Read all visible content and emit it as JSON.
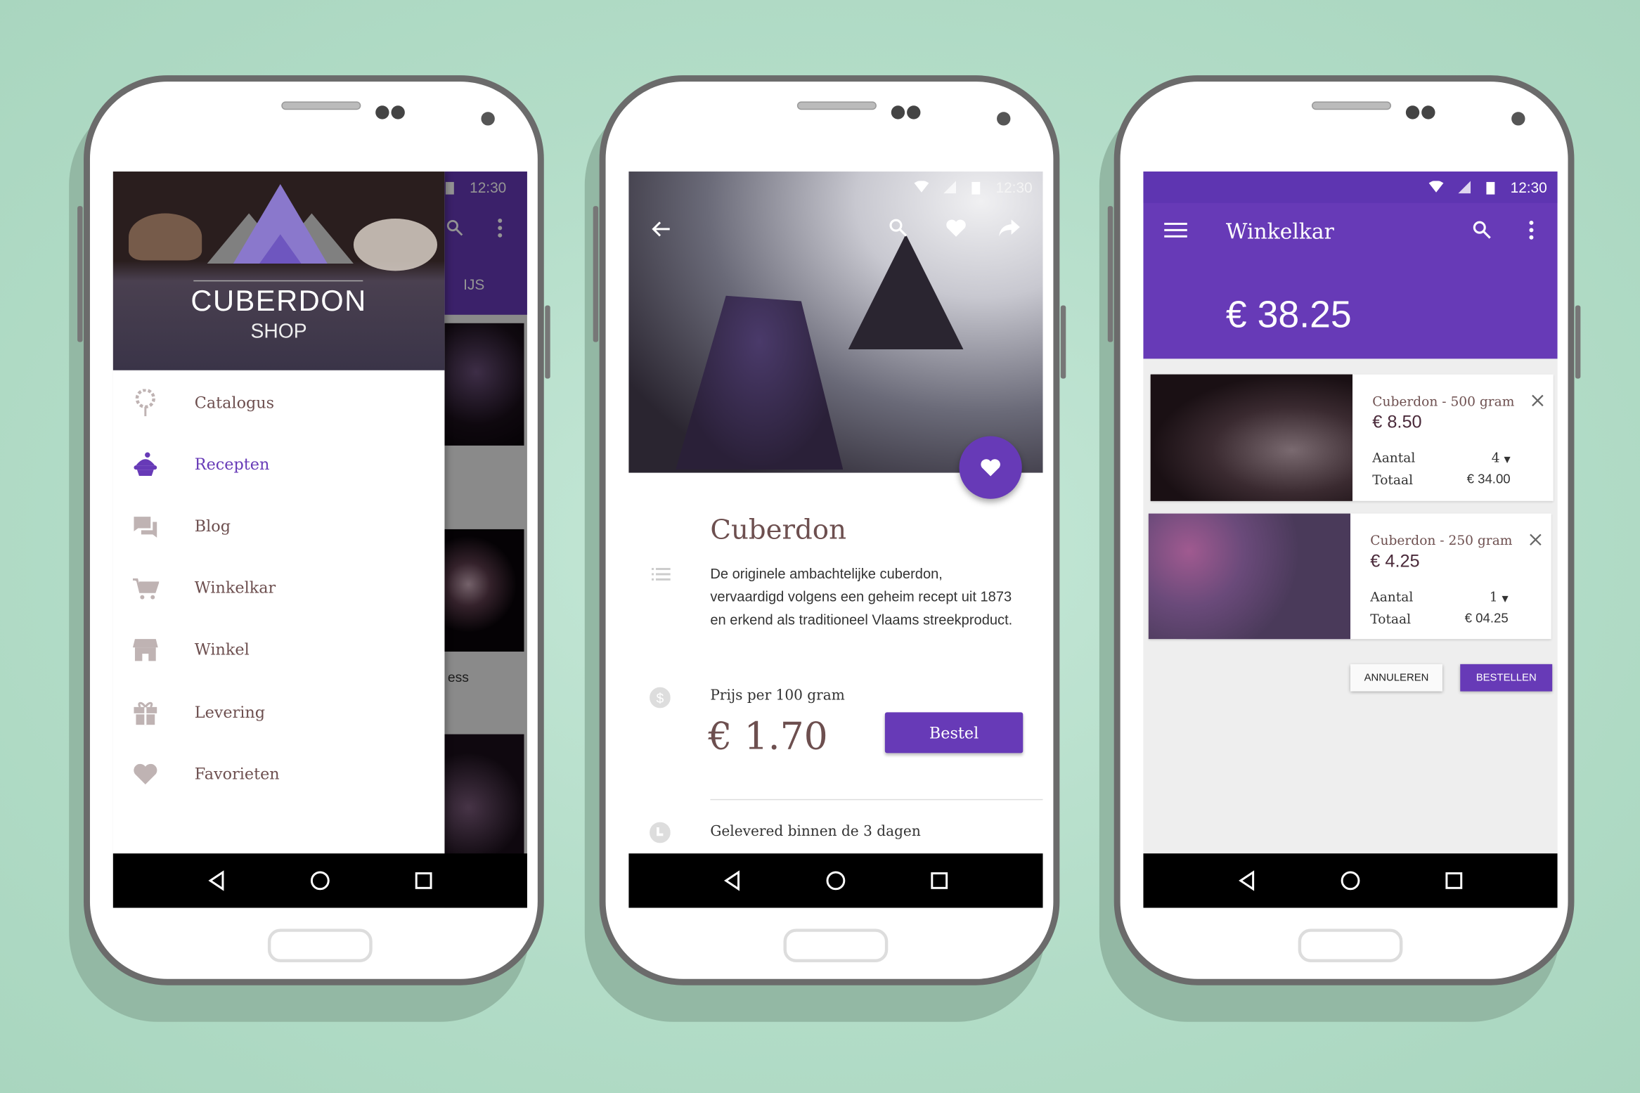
{
  "colors": {
    "accent": "#673ab7",
    "accent_dark": "#5e35b1",
    "text_brown": "#6d4f4f",
    "background": "#b2dcc7"
  },
  "status": {
    "time": "12:30"
  },
  "phone1": {
    "brand": {
      "title": "CUBERDON",
      "subtitle": "SHOP"
    },
    "behind_tab": "IJS",
    "behind_text": "ess",
    "menu": [
      {
        "label": "Catalogus",
        "icon": "lollipop-icon",
        "active": false
      },
      {
        "label": "Recepten",
        "icon": "cupcake-icon",
        "active": true
      },
      {
        "label": "Blog",
        "icon": "chat-icon",
        "active": false
      },
      {
        "label": "Winkelkar",
        "icon": "cart-icon",
        "active": false
      },
      {
        "label": "Winkel",
        "icon": "store-icon",
        "active": false
      },
      {
        "label": "Levering",
        "icon": "gift-icon",
        "active": false
      },
      {
        "label": "Favorieten",
        "icon": "heart-icon",
        "active": false
      }
    ]
  },
  "phone2": {
    "title": "Cuberdon",
    "description": "De originele ambachtelijke cuberdon, vervaardigd volgens een geheim recept uit 1873 en erkend als traditioneel Vlaams streekproduct.",
    "price_label": "Prijs per 100 gram",
    "price": "€ 1.70",
    "order_button": "Bestel",
    "delivery": "Gelevered binnen de 3 dagen"
  },
  "phone3": {
    "title": "Winkelkar",
    "total": "€ 38.25",
    "items": [
      {
        "name": "Cuberdon - 500 gram",
        "price": "€ 8.50",
        "qty_label": "Aantal",
        "qty": "4",
        "total_label": "Totaal",
        "total": "€ 34.00"
      },
      {
        "name": "Cuberdon - 250 gram",
        "price": "€ 4.25",
        "qty_label": "Aantal",
        "qty": "1",
        "total_label": "Totaal",
        "total": "€ 04.25"
      }
    ],
    "cancel_button": "ANNULEREN",
    "order_button": "BESTELLEN"
  }
}
